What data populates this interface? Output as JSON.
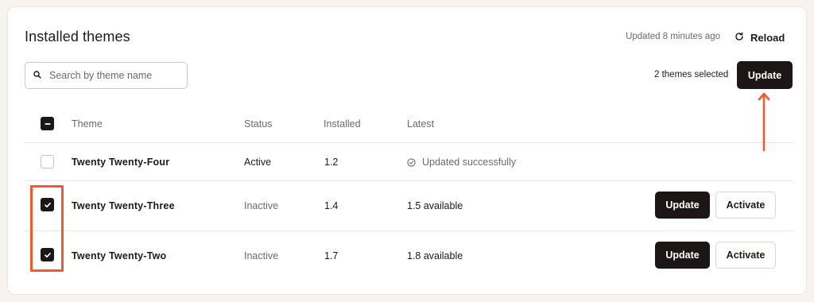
{
  "header": {
    "title": "Installed themes",
    "updated_ago": "Updated 8 minutes ago",
    "reload_label": "Reload"
  },
  "search": {
    "placeholder": "Search by theme name",
    "value": ""
  },
  "selection": {
    "count_label": "2 themes selected",
    "update_label": "Update"
  },
  "table": {
    "columns": [
      "Theme",
      "Status",
      "Installed",
      "Latest"
    ],
    "rows": [
      {
        "name": "Twenty Twenty-Four",
        "status": "Active",
        "installed": "1.2",
        "latest": "Updated successfully",
        "checked": false
      },
      {
        "name": "Twenty Twenty-Three",
        "status": "Inactive",
        "installed": "1.4",
        "latest": "1.5 available",
        "checked": true,
        "update_label": "Update",
        "activate_label": "Activate"
      },
      {
        "name": "Twenty Twenty-Two",
        "status": "Inactive",
        "installed": "1.7",
        "latest": "1.8 available",
        "checked": true,
        "update_label": "Update",
        "activate_label": "Activate"
      }
    ]
  },
  "annotations": {
    "highlight_color": "#f4592a"
  },
  "icons": [
    "reload-icon",
    "search-icon",
    "check-circle-icon",
    "checkmark-icon",
    "minus-icon"
  ]
}
